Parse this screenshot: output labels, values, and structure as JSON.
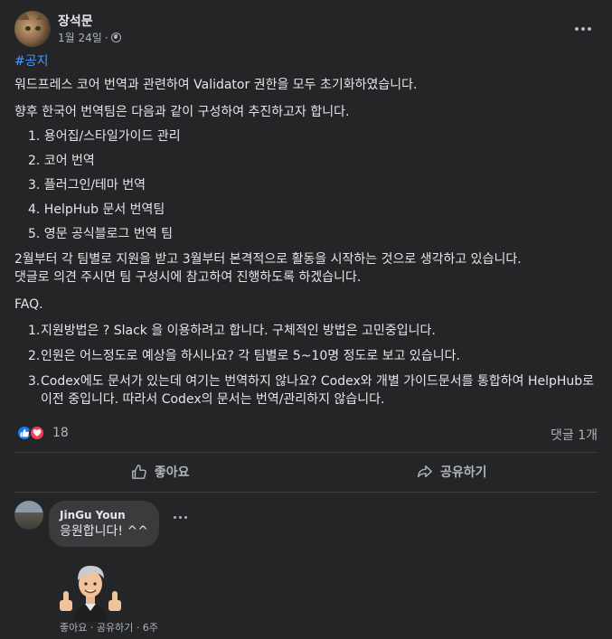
{
  "post": {
    "author": "장석문",
    "date": "1월 24일",
    "separator": "·",
    "privacy_icon": "globe-icon",
    "hashtag": "#공지",
    "paragraph1": "워드프레스 코어 번역과 관련하여 Validator 권한을 모두 초기화하였습니다.",
    "paragraph2": "향후 한국어 번역팀은 다음과 같이 구성하여 추진하고자 합니다.",
    "team_list": [
      "1. 용어집/스타일가이드 관리",
      "2. 코어 번역",
      "3. 플러그인/테마 번역",
      "4. HelpHub 문서 번역팀",
      "5. 영문 공식블로그 번역 팀"
    ],
    "paragraph3a": "2월부터 각 팀별로 지원을 받고 3월부터 본격적으로 활동을 시작하는 것으로 생각하고 있습니다.",
    "paragraph3b": "댓글로 의견 주시면 팀 구성시에 참고하여 진행하도록 하겠습니다.",
    "faq_title": "FAQ.",
    "faq": [
      {
        "num": "1.",
        "text": "지원방법은 ? Slack 을 이용하려고 합니다. 구체적인 방법은 고민중입니다."
      },
      {
        "num": "2.",
        "text": "인원은 어느정도로 예상을 하시나요? 각 팀별로 5~10명 정도로 보고 있습니다."
      },
      {
        "num": "3.",
        "text": "Codex에도 문서가 있는데 여기는 번역하지 않나요? Codex와 개별 가이드문서를 통합하여 HelpHub로 이전 중입니다. 따라서 Codex의 문서는 번역/관리하지 않습니다."
      }
    ]
  },
  "stats": {
    "reaction_count": "18",
    "comment_count": "댓글 1개"
  },
  "actions": {
    "like": "좋아요",
    "share": "공유하기"
  },
  "comment": {
    "author": "JinGu Youn",
    "text": "응원합니다! ^^",
    "meta": "좋아요 · 공유하기 · 6주"
  },
  "colors": {
    "background": "#242526",
    "hashtag": "#4599ff",
    "like": "#1877f2",
    "love": "#f33e58"
  }
}
